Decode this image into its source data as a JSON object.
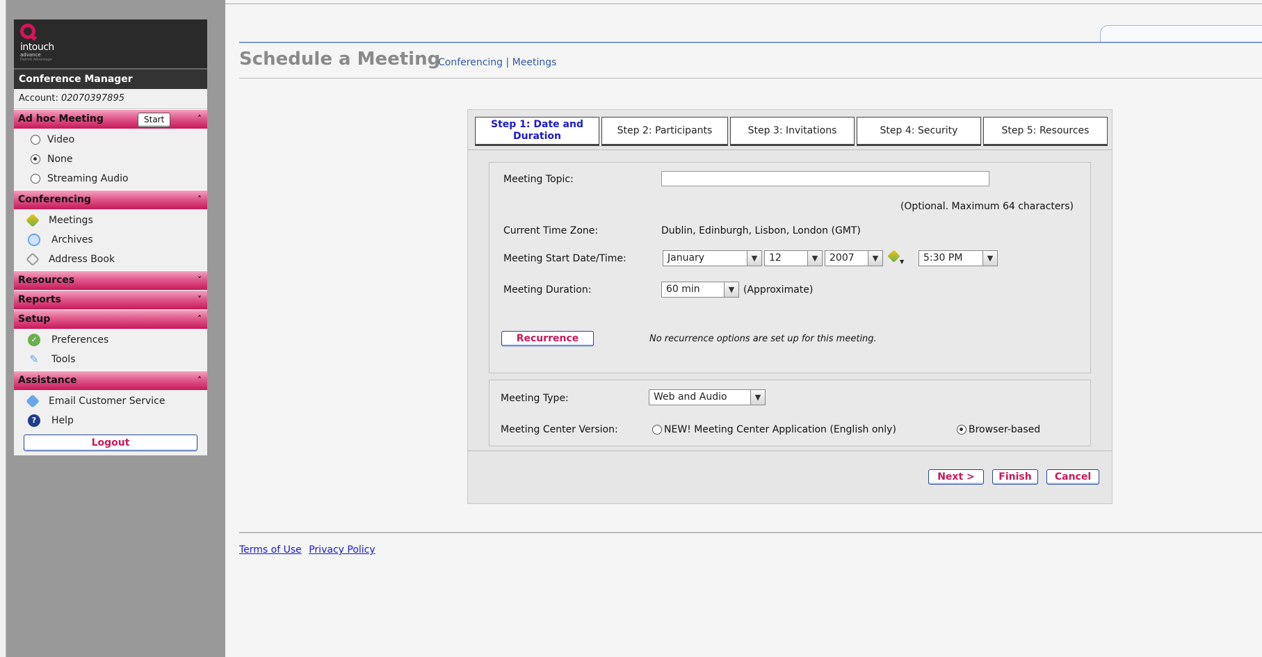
{
  "sidebar": {
    "logo": {
      "name": "intouch",
      "sub": "advance",
      "tagline": "Detroit Advantage"
    },
    "title": "Conference Manager",
    "account_label": "Account:",
    "account_number": "02070397895",
    "adhoc": {
      "label": "Ad hoc Meeting",
      "start_label": "Start",
      "chevron": "˄",
      "options": [
        {
          "label": "Video",
          "checked": false
        },
        {
          "label": "None",
          "checked": true
        },
        {
          "label": "Streaming Audio",
          "checked": false
        }
      ]
    },
    "conferencing": {
      "label": "Conferencing",
      "chevron": "˄",
      "items": [
        {
          "label": "Meetings",
          "icon": "meetings-icon"
        },
        {
          "label": "Archives",
          "icon": "archives-icon"
        },
        {
          "label": "Address Book",
          "icon": "address-book-icon"
        }
      ]
    },
    "resources": {
      "label": "Resources",
      "chevron": "˅"
    },
    "reports": {
      "label": "Reports",
      "chevron": "˅"
    },
    "setup": {
      "label": "Setup",
      "chevron": "˄",
      "items": [
        {
          "label": "Preferences",
          "icon": "preferences-icon"
        },
        {
          "label": "Tools",
          "icon": "tools-icon"
        }
      ]
    },
    "assistance": {
      "label": "Assistance",
      "chevron": "˄",
      "items": [
        {
          "label": "Email Customer Service",
          "icon": "email-icon"
        },
        {
          "label": "Help",
          "icon": "help-icon"
        }
      ]
    },
    "logout_label": "Logout"
  },
  "header": {
    "title": "Schedule a Meeting",
    "breadcrumb": {
      "first": "Conferencing",
      "separator": "|",
      "second": "Meetings"
    }
  },
  "wizard": {
    "tabs": [
      {
        "label": "Step 1: Date and Duration",
        "active": true
      },
      {
        "label": "Step 2: Participants",
        "active": false
      },
      {
        "label": "Step 3: Invitations",
        "active": false
      },
      {
        "label": "Step 4: Security",
        "active": false
      },
      {
        "label": "Step 5: Resources",
        "active": false
      }
    ],
    "topic": {
      "label": "Meeting Topic:",
      "value": "",
      "hint": "(Optional. Maximum 64 characters)"
    },
    "timezone": {
      "label": "Current Time Zone:",
      "value": "Dublin, Edinburgh, Lisbon, London (GMT)"
    },
    "start": {
      "label": "Meeting Start Date/Time:",
      "month": "January",
      "day": "12",
      "year": "2007",
      "time": "5:30 PM"
    },
    "duration": {
      "label": "Meeting Duration:",
      "value": "60 min",
      "note": "(Approximate)"
    },
    "recurrence": {
      "button": "Recurrence",
      "note": "No recurrence options are set up for this meeting."
    },
    "meeting_type": {
      "label": "Meeting Type:",
      "value": "Web and Audio"
    },
    "center_version": {
      "label": "Meeting Center Version:",
      "option1": "NEW! Meeting Center Application (English only)",
      "option1_checked": false,
      "option2": "Browser-based",
      "option2_checked": true
    },
    "buttons": {
      "next": "Next >",
      "finish": "Finish",
      "cancel": "Cancel"
    }
  },
  "footer": {
    "terms": "Terms of Use",
    "privacy": "Privacy Policy"
  },
  "colors": {
    "accent_pink": "#c8195a",
    "link_blue": "#2d5aa0",
    "sidebar_bg": "#999999"
  }
}
